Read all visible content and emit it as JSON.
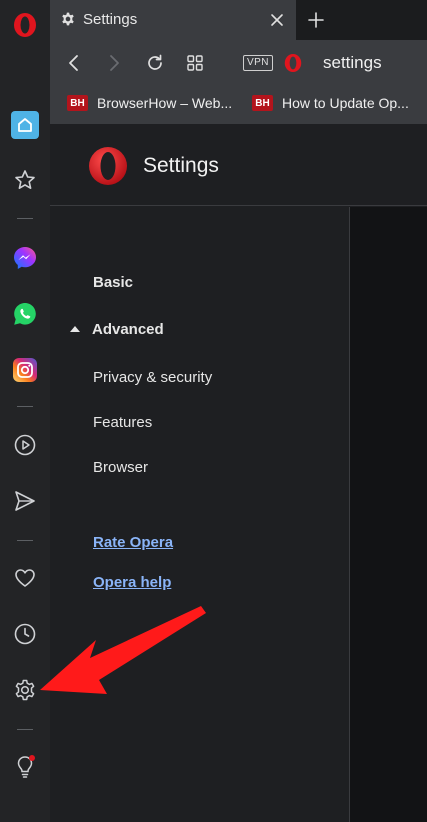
{
  "browser": {
    "tab": {
      "title": "Settings"
    },
    "address": {
      "text": "settings",
      "vpn_label": "VPN"
    },
    "bookmarks": [
      {
        "badge": "BH",
        "label": "BrowserHow – Web..."
      },
      {
        "badge": "BH",
        "label": "How to Update Op..."
      }
    ]
  },
  "sidebar": {
    "items": [
      "opera-logo",
      "home-icon",
      "star-icon",
      "messenger-icon",
      "whatsapp-icon",
      "instagram-icon",
      "player-icon",
      "send-icon",
      "heart-icon",
      "history-icon",
      "gear-icon",
      "lightbulb-icon"
    ]
  },
  "settings": {
    "title": "Settings",
    "nav": {
      "basic": "Basic",
      "advanced": "Advanced",
      "privacy": "Privacy & security",
      "features": "Features",
      "browser": "Browser",
      "rate": "Rate Opera",
      "help": "Opera help"
    }
  },
  "colors": {
    "accent_red": "#e0151e",
    "link_blue": "#8ab4f8",
    "sidebar_bg": "#232426"
  }
}
